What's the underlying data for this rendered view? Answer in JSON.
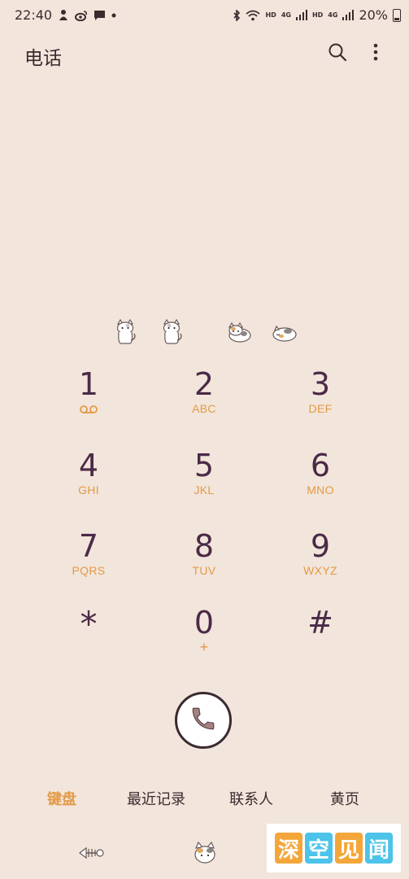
{
  "status_bar": {
    "time": "22:40",
    "network_label_1": "HD",
    "network_label_2": "4G",
    "network_label_3": "HD",
    "network_label_4": "4G",
    "battery_percent": "20%",
    "icons": [
      "notification-icon",
      "weibo-icon",
      "message-icon",
      "dot-icon",
      "bluetooth-icon",
      "wifi-icon",
      "signal-icon",
      "signal-icon",
      "battery-icon"
    ]
  },
  "header": {
    "title": "电话",
    "search_icon": "search-icon",
    "more_icon": "more-vertical-icon"
  },
  "keypad": {
    "keys": [
      {
        "digit": "1",
        "letters": "",
        "voicemail": true
      },
      {
        "digit": "2",
        "letters": "ABC"
      },
      {
        "digit": "3",
        "letters": "DEF"
      },
      {
        "digit": "4",
        "letters": "GHI"
      },
      {
        "digit": "5",
        "letters": "JKL"
      },
      {
        "digit": "6",
        "letters": "MNO"
      },
      {
        "digit": "7",
        "letters": "PQRS"
      },
      {
        "digit": "8",
        "letters": "TUV"
      },
      {
        "digit": "9",
        "letters": "WXYZ"
      },
      {
        "digit": "*",
        "letters": ""
      },
      {
        "digit": "0",
        "letters": "+"
      },
      {
        "digit": "#",
        "letters": ""
      }
    ]
  },
  "call_button": {
    "icon": "phone-icon"
  },
  "tabs": [
    {
      "label": "键盘",
      "active": true
    },
    {
      "label": "最近记录",
      "active": false
    },
    {
      "label": "联系人",
      "active": false
    },
    {
      "label": "黄页",
      "active": false
    }
  ],
  "watermark": {
    "chars": [
      "深",
      "空",
      "见",
      "闻"
    ],
    "colors": [
      "#f4a63a",
      "#4cc3e8",
      "#f4a63a",
      "#4cc3e8"
    ]
  },
  "colors": {
    "background": "#f2e5db",
    "digit": "#4a2a47",
    "letters": "#e39a45",
    "active_tab": "#e39a45",
    "call_handset": "#a3827f"
  }
}
